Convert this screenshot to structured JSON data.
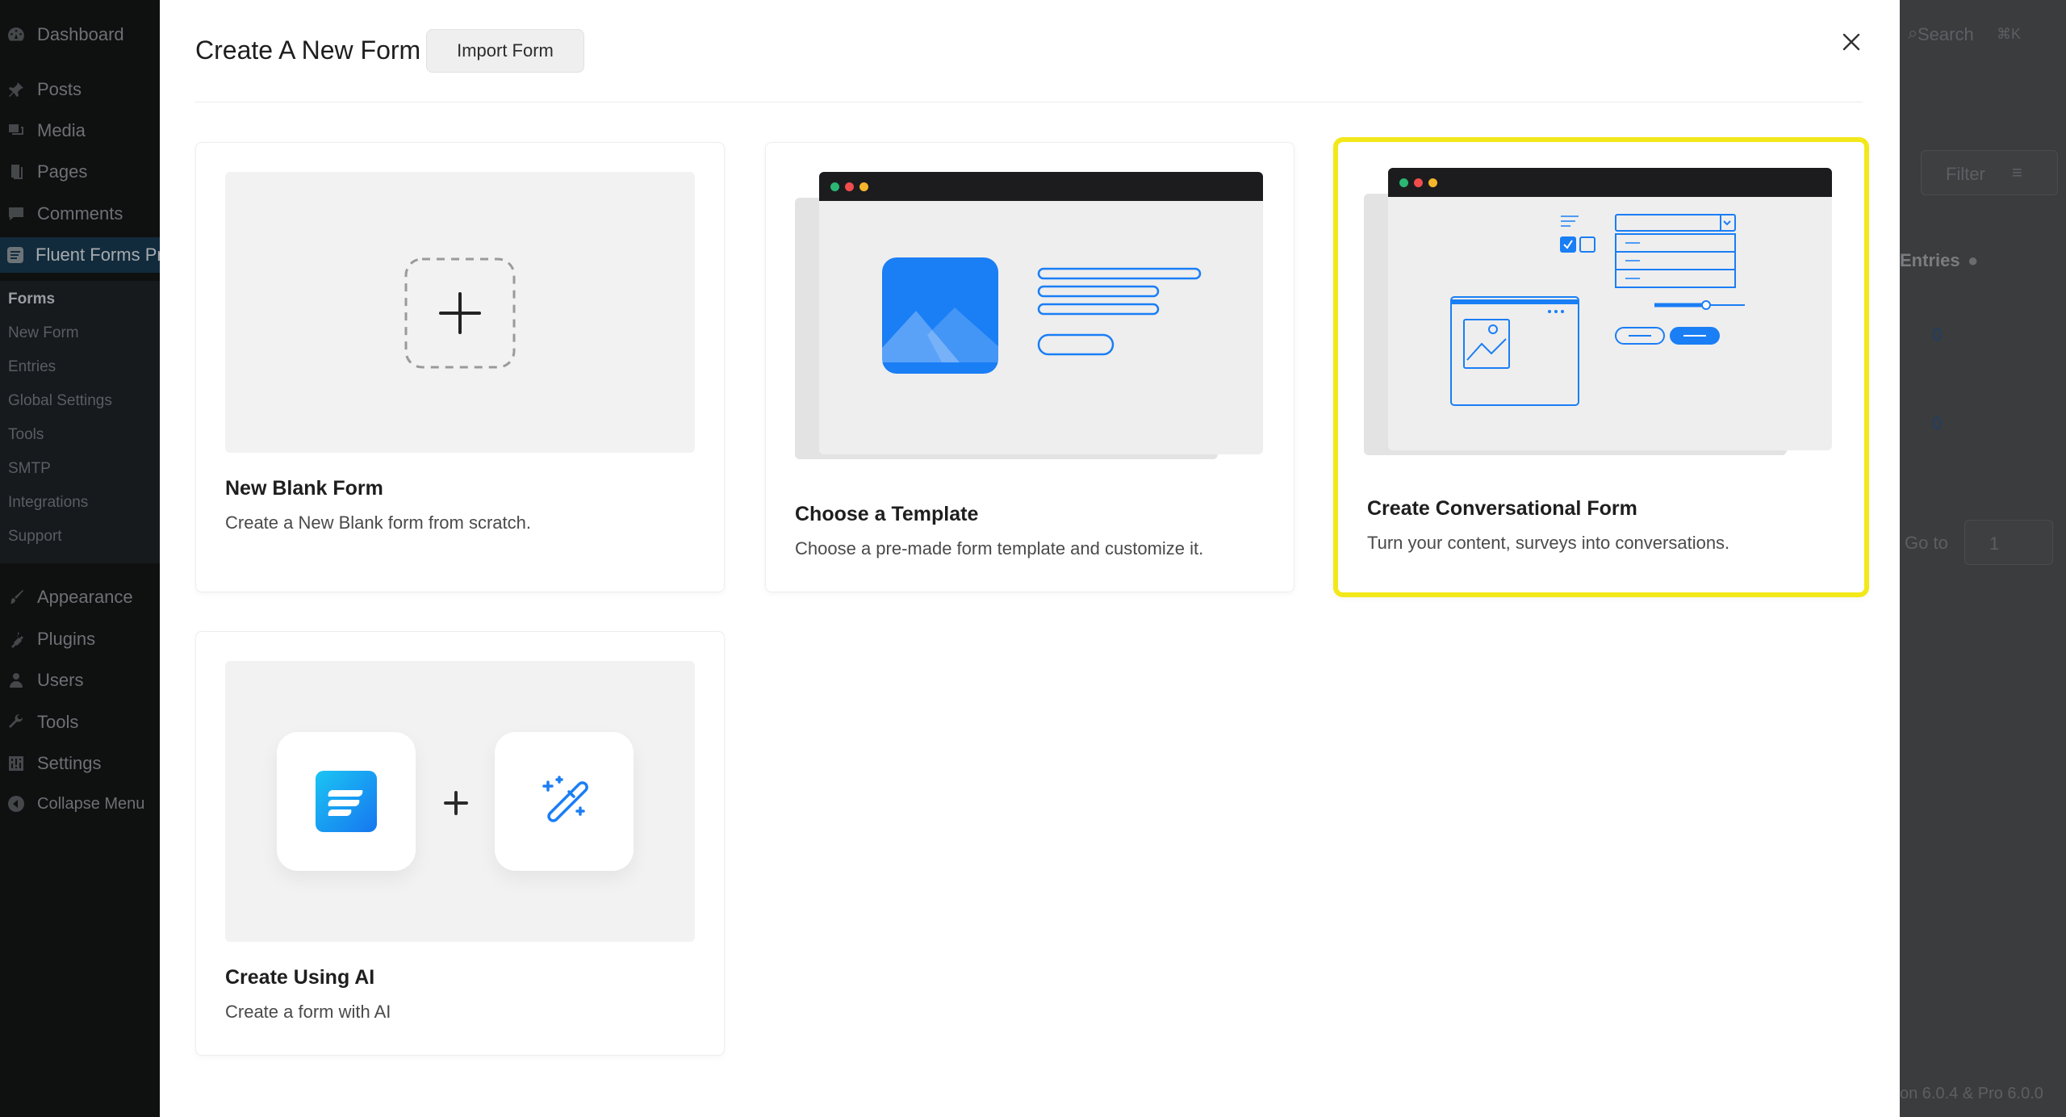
{
  "sidebar": {
    "items": [
      {
        "label": "Dashboard",
        "icon": "dashboard-icon"
      },
      {
        "label": "Posts",
        "icon": "pin-icon"
      },
      {
        "label": "Media",
        "icon": "media-icon"
      },
      {
        "label": "Pages",
        "icon": "pages-icon"
      },
      {
        "label": "Comments",
        "icon": "comments-icon"
      },
      {
        "label": "Fluent Forms Pr",
        "icon": "fluent-forms-icon"
      },
      {
        "label": "Appearance",
        "icon": "brush-icon"
      },
      {
        "label": "Plugins",
        "icon": "plugin-icon"
      },
      {
        "label": "Users",
        "icon": "users-icon"
      },
      {
        "label": "Tools",
        "icon": "wrench-icon"
      },
      {
        "label": "Settings",
        "icon": "settings-icon"
      },
      {
        "label": "Collapse Menu",
        "icon": "collapse-icon"
      }
    ],
    "submenu": [
      "Forms",
      "New Form",
      "Entries",
      "Global Settings",
      "Tools",
      "SMTP",
      "Integrations",
      "Support"
    ]
  },
  "background": {
    "search_label": "Search",
    "search_shortcut": "⌘K",
    "filter_label": "Filter",
    "entries_header": "Entries",
    "entries_values": [
      "0",
      "0"
    ],
    "goto_label": "Go to",
    "goto_value": "1",
    "version_text": "on 6.0.4 & Pro 6.0.0"
  },
  "modal": {
    "title": "Create A New Form",
    "import_label": "Import Form",
    "cards": [
      {
        "title": "New Blank Form",
        "description": "Create a New Blank form from scratch."
      },
      {
        "title": "Choose a Template",
        "description": "Choose a pre-made form template and customize it."
      },
      {
        "title": "Create Conversational Form",
        "description": "Turn your content, surveys into conversations."
      },
      {
        "title": "Create Using AI",
        "description": "Create a form with AI"
      }
    ]
  },
  "colors": {
    "highlight": "#f2e81a",
    "accent": "#1a7ef5",
    "sidebar_bg": "#0f1010",
    "overlay_bg": "#3b3c3e"
  }
}
